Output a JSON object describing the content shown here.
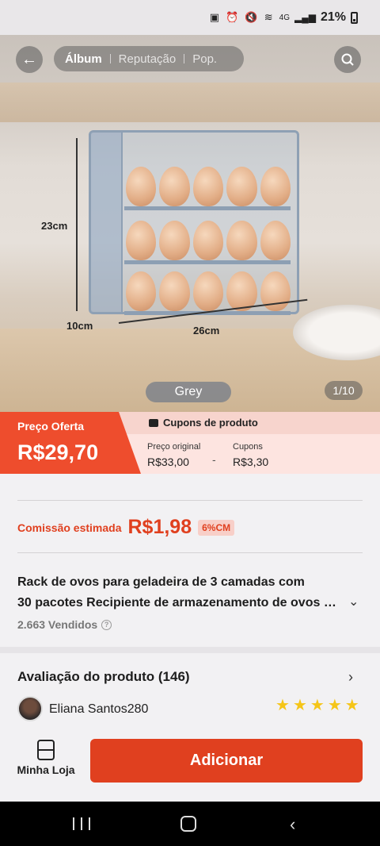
{
  "status_bar": {
    "battery": "21%",
    "network_text": "4G"
  },
  "gallery": {
    "tabs": [
      {
        "label": "Álbum",
        "active": true
      },
      {
        "label": "Reputação",
        "active": false
      },
      {
        "label": "Pop.",
        "active": false
      }
    ],
    "dimensions": {
      "height": "23cm",
      "depth": "10cm",
      "width": "26cm"
    },
    "variant_chip": "Grey",
    "counter": "1/10"
  },
  "price": {
    "offer_label": "Preço Oferta",
    "offer_value": "R$29,70",
    "coupons_header": "Cupons de produto",
    "original_label": "Preço original",
    "original_value": "R$33,00",
    "separator": "-",
    "coupons_label": "Cupons",
    "coupons_value": "R$3,30"
  },
  "commission": {
    "label": "Comissão estimada",
    "value": "R$1,98",
    "badge": "6%CM"
  },
  "product": {
    "title_line1": "Rack de ovos para geladeira de 3 camadas com",
    "title_line2": "30 pacotes Recipiente de armazenamento de ovos do...",
    "sold": "2.663 Vendidos"
  },
  "reviews": {
    "title": "Avaliação do produto (146)",
    "reviewer": "Eliana Santos280",
    "rating": 5
  },
  "bottom_bar": {
    "store_label": "Minha Loja",
    "add_label": "Adicionar"
  },
  "colors": {
    "accent": "#ee4d2d",
    "accent_dark": "#e0401f",
    "price_band_bg": "#fde4e0",
    "star": "#f5c518"
  }
}
